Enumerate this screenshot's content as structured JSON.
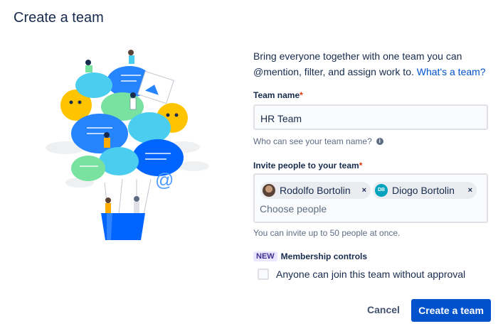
{
  "dialog": {
    "title": "Create a team"
  },
  "intro": {
    "text": "Bring everyone together with one team you can @mention, filter, and assign work to.",
    "link": "What's a team?"
  },
  "team_name": {
    "label": "Team name",
    "required_mark": "*",
    "value": "HR Team",
    "help": "Who can see your team name?",
    "help_icon": "info-icon"
  },
  "invite": {
    "label": "Invite people to your team",
    "required_mark": "*",
    "chips": [
      {
        "name": "Rodolfo Bortolin",
        "avatar": "photo",
        "remove": "×"
      },
      {
        "name": "Diogo Bortolin",
        "avatar_initials": "DB",
        "remove": "×"
      }
    ],
    "placeholder": "Choose people",
    "help": "You can invite up to 50 people at once."
  },
  "membership": {
    "badge": "NEW",
    "label": "Membership controls",
    "checkbox_label": "Anyone can join this team without approval",
    "checked": false
  },
  "actions": {
    "cancel": "Cancel",
    "create": "Create a team"
  },
  "colors": {
    "primary": "#0052cc",
    "text": "#172b4d",
    "subtle": "#5e6c84",
    "badge_bg": "#eae6ff",
    "badge_text": "#403294"
  }
}
